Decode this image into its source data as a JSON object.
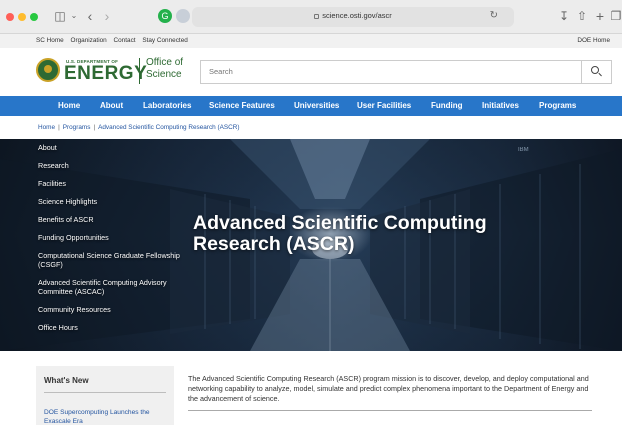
{
  "browser": {
    "url": "science.osti.gov/ascr"
  },
  "utility_bar": {
    "links": [
      "SC Home",
      "Organization",
      "Contact",
      "Stay Connected"
    ],
    "doe_home": "DOE Home"
  },
  "header": {
    "dept_line": "U.S. DEPARTMENT OF",
    "energy": "ENERGY",
    "office_line1": "Office of",
    "office_line2": "Science",
    "search_placeholder": "Search"
  },
  "main_nav": [
    "Home",
    "About",
    "Laboratories",
    "Science Features",
    "Universities",
    "User Facilities",
    "Funding",
    "Initiatives",
    "Programs"
  ],
  "breadcrumb": [
    "Home",
    "Programs",
    "Advanced Scientific Computing Research (ASCR)"
  ],
  "side_nav": [
    "About",
    "Research",
    "Facilities",
    "Science Highlights",
    "Benefits of ASCR",
    "Funding Opportunities",
    "Computational Science Graduate Fellowship (CSGF)",
    "Advanced Scientific Computing Advisory Committee (ASCAC)",
    "Community Resources",
    "Office Hours"
  ],
  "hero": {
    "title": "Advanced Scientific Computing Research (ASCR)",
    "rack_brand": "IBM"
  },
  "whats_new": {
    "title": "What's New",
    "link": "DOE Supercomputing Launches the Exascale Era"
  },
  "mission_text": "The Advanced Scientific Computing Research (ASCR) program mission is to discover, develop, and deploy computational and networking capability to analyze, model, simulate and predict complex phenomena important to the Department of Energy and the advancement of science.",
  "colors": {
    "nav_blue": "#2876c9",
    "doe_green": "#2e6a33",
    "link_blue": "#2455a0"
  }
}
